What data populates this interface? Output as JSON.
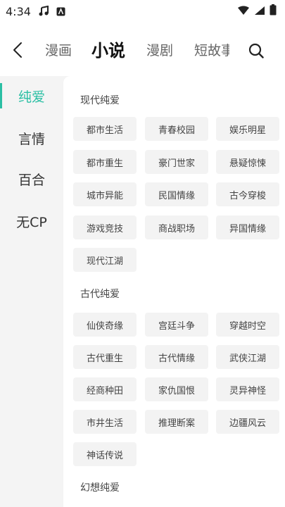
{
  "status_bar": {
    "time": "4:34"
  },
  "header": {
    "tabs": [
      {
        "label": "漫画"
      },
      {
        "label": "小说",
        "active": true
      },
      {
        "label": "漫剧"
      },
      {
        "label": "短故事"
      }
    ]
  },
  "sidebar": {
    "items": [
      {
        "label": "纯爱",
        "active": true
      },
      {
        "label": "言情"
      },
      {
        "label": "百合"
      },
      {
        "label": "无CP"
      }
    ]
  },
  "sections": [
    {
      "title": "现代纯爱",
      "tags": [
        "都市生活",
        "青春校园",
        "娱乐明星",
        "都市重生",
        "豪门世家",
        "悬疑惊悚",
        "城市异能",
        "民国情缘",
        "古今穿梭",
        "游戏竞技",
        "商战职场",
        "异国情缘",
        "现代江湖"
      ]
    },
    {
      "title": "古代纯爱",
      "tags": [
        "仙侠奇缘",
        "宫廷斗争",
        "穿越时空",
        "古代重生",
        "古代情缘",
        "武侠江湖",
        "经商种田",
        "家仇国恨",
        "灵异神怪",
        "市井生活",
        "推理断案",
        "边疆风云",
        "神话传说"
      ]
    },
    {
      "title": "幻想纯爱",
      "tags": []
    }
  ],
  "colors": {
    "accent": "#2bbfa4",
    "chip_bg": "#f3f3f3",
    "page_bg": "#f4f4f4"
  }
}
